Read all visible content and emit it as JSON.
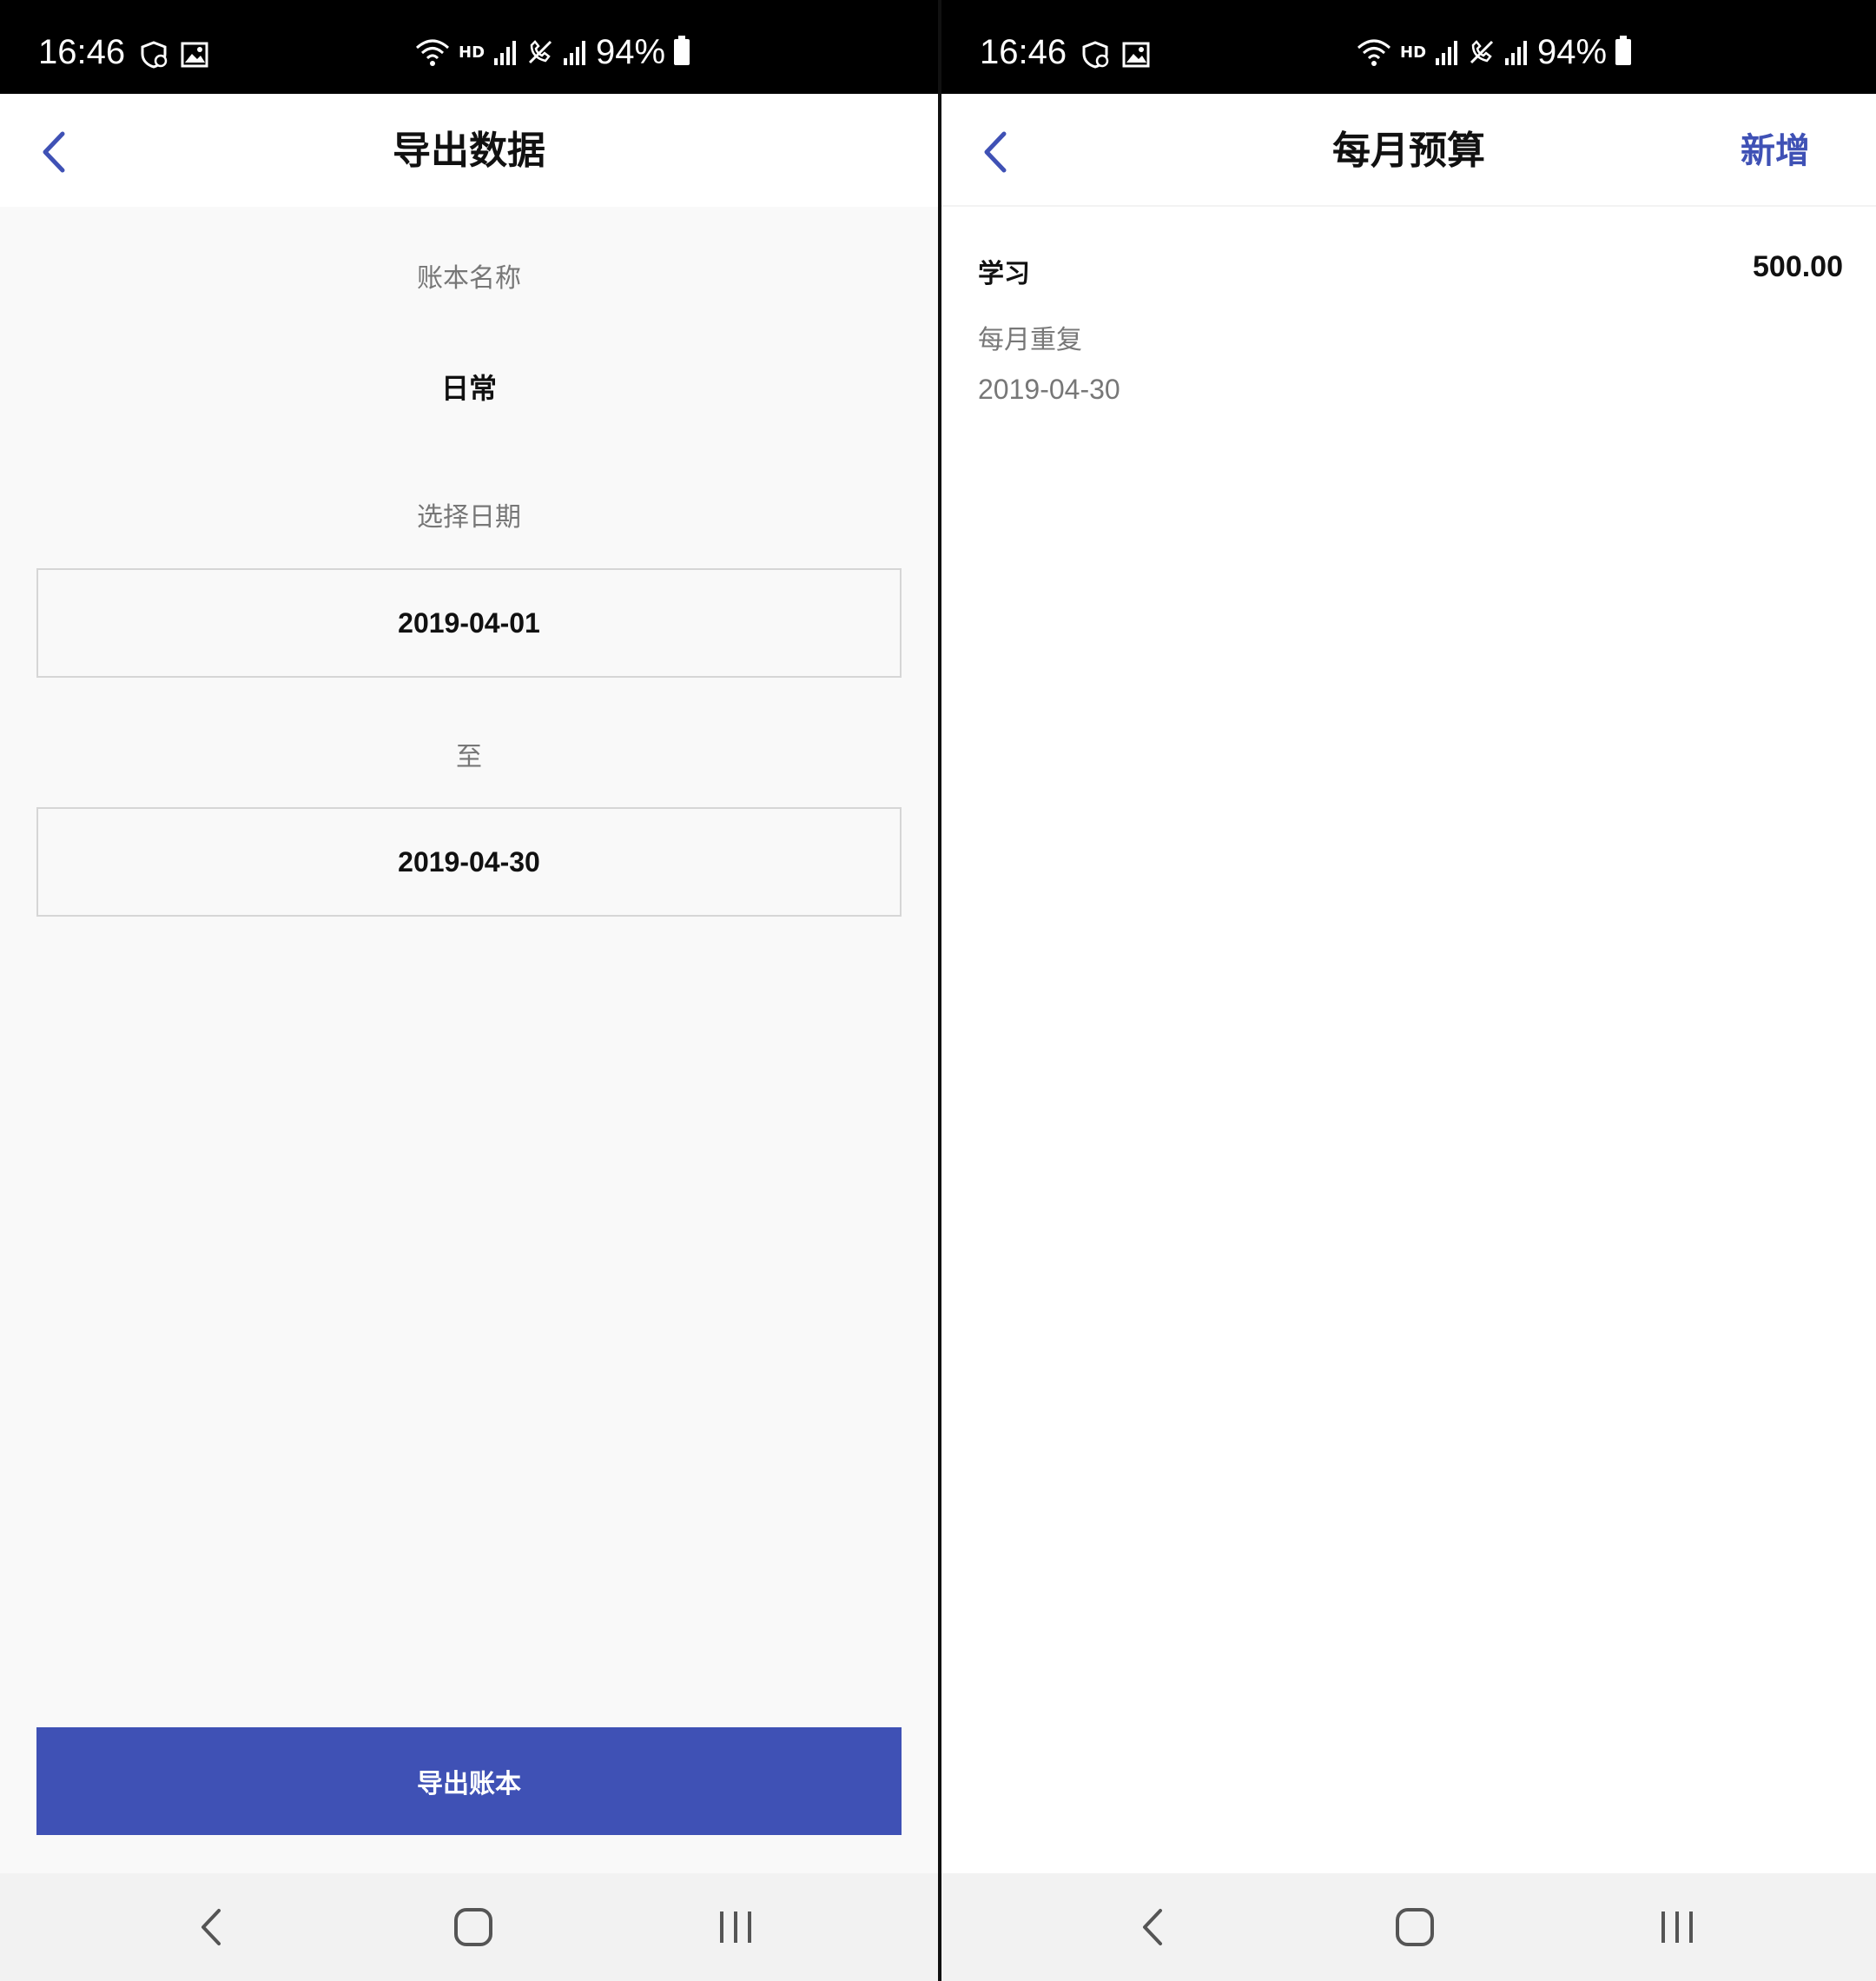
{
  "status_bar": {
    "time": "16:46",
    "hd_label": "HD",
    "battery_text": "94%"
  },
  "export_screen": {
    "title": "导出数据",
    "book_name_label": "账本名称",
    "book_name_value": "日常",
    "date_label": "选择日期",
    "start_date": "2019-04-01",
    "to_label": "至",
    "end_date": "2019-04-30",
    "export_button_label": "导出账本"
  },
  "budget_screen": {
    "title": "每月预算",
    "add_label": "新增",
    "items": [
      {
        "category": "学习",
        "amount": "500.00",
        "repeat": "每月重复",
        "date": "2019-04-30"
      }
    ]
  },
  "colors": {
    "accent": "#3f51b5",
    "background": "#f9f9f9",
    "muted_text": "#777777"
  }
}
